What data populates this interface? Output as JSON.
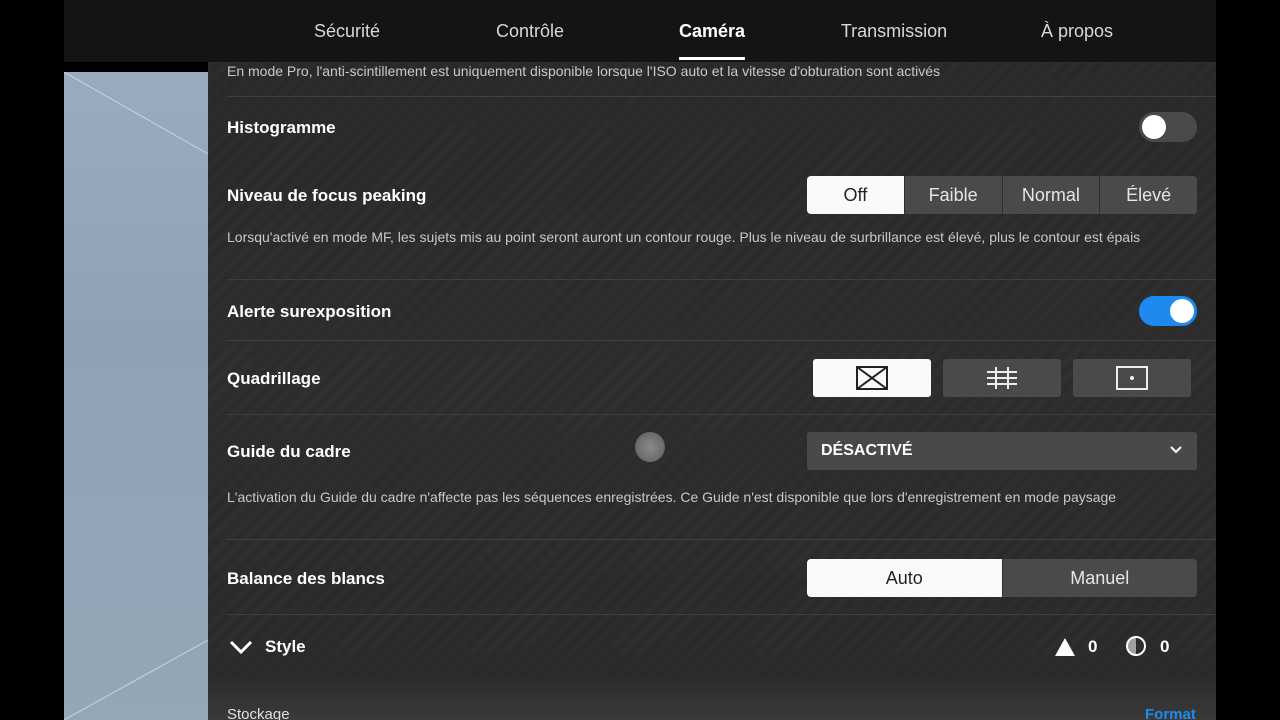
{
  "tabs": [
    {
      "label": "Sécurité"
    },
    {
      "label": "Contrôle"
    },
    {
      "label": "Caméra"
    },
    {
      "label": "Transmission"
    },
    {
      "label": "À propos"
    }
  ],
  "active_tab": "Caméra",
  "anti_flicker_note": "En mode Pro, l'anti-scintillement est uniquement disponible lorsque l'ISO auto et la vitesse d'obturation sont activés",
  "histogram": {
    "label": "Histogramme",
    "enabled": false
  },
  "focus_peaking": {
    "label": "Niveau de focus peaking",
    "options": [
      "Off",
      "Faible",
      "Normal",
      "Élevé"
    ],
    "selected": "Off",
    "description": "Lorsqu'activé en mode MF, les sujets mis au point seront auront un contour rouge. Plus le niveau de surbrillance est élevé, plus le contour est épais"
  },
  "overexposure": {
    "label": "Alerte surexposition",
    "enabled": true
  },
  "grid": {
    "label": "Quadrillage",
    "options": [
      "diagonal-grid-icon",
      "grid-lines-icon",
      "center-point-icon"
    ],
    "selected": "diagonal-grid-icon"
  },
  "frame_guide": {
    "label": "Guide du cadre",
    "value": "DÉSACTIVÉ",
    "description": "L'activation du Guide du cadre n'affecte pas les séquences enregistrées. Ce Guide n'est disponible que lors d'enregistrement en mode paysage"
  },
  "white_balance": {
    "label": "Balance des blancs",
    "options": [
      "Auto",
      "Manuel"
    ],
    "selected": "Auto"
  },
  "style": {
    "label": "Style",
    "sharpness": "0",
    "contrast": "0"
  },
  "storage": {
    "label": "Stockage",
    "action": "Format"
  },
  "colors": {
    "accent": "#1e8af0",
    "panel": "#2b2b2b",
    "topbar": "#141414"
  }
}
